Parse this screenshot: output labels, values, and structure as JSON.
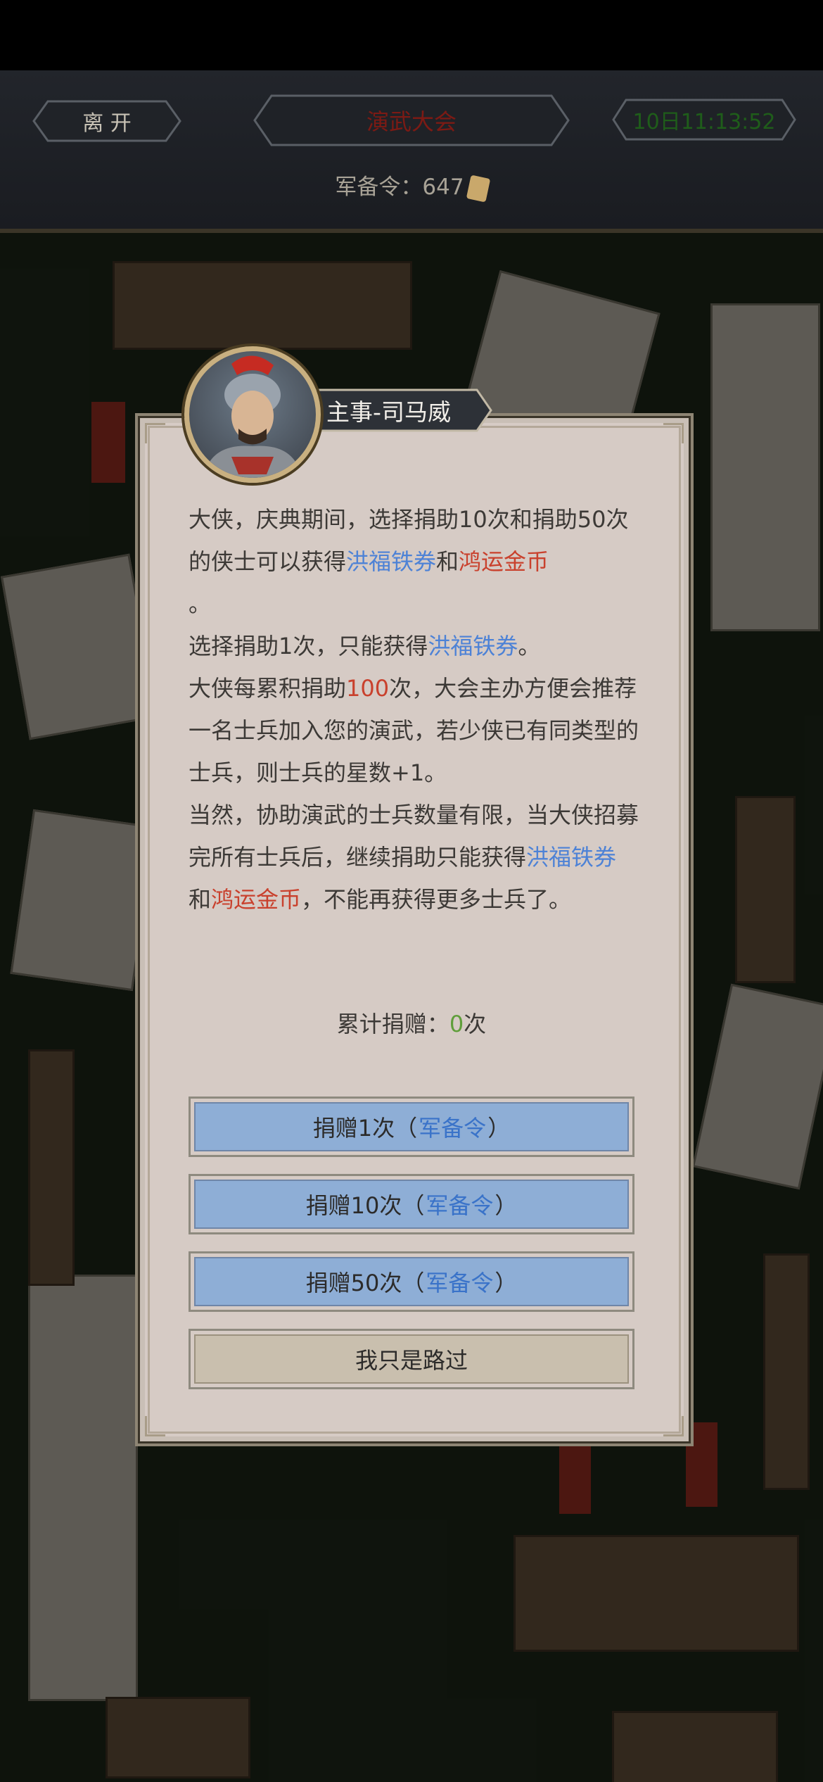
{
  "topbar": {
    "leave_label": "离 开",
    "title": "演武大会",
    "timer": "10日11:13:52",
    "resource_label": "军备令：647"
  },
  "dialog": {
    "speaker": "主事-司马威",
    "para1_a": "大侠，庆典期间，选择捐助10次和捐助50次的侠士可以获得",
    "para1_blue": "洪福铁券",
    "para1_and": "和",
    "para1_red": "鸿运金币",
    "para1_end": "。",
    "para2_a": "选择捐助1次，只能获得",
    "para2_blue": "洪福铁券",
    "para2_end": "。",
    "para3_a": "大侠每累积捐助",
    "para3_red": "100",
    "para3_b": "次，大会主办方便会推荐一名士兵加入您的演武，若少侠已有同类型的士兵，则士兵的星数+1。",
    "para4_a": "当然，协助演武的士兵数量有限，当大侠招募完所有士兵后，继续捐助只能获得",
    "para4_blue": "洪福铁券",
    "para4_and": "和",
    "para4_red": "鸿运金币",
    "para4_end": "，不能再获得更多士兵了。",
    "total_label": "累计捐赠：",
    "total_value": "0",
    "total_unit": "次",
    "buttons": [
      {
        "prefix": "捐赠1次（",
        "currency": "军备令",
        "suffix": "）"
      },
      {
        "prefix": "捐赠10次（",
        "currency": "军备令",
        "suffix": "）"
      },
      {
        "prefix": "捐赠50次（",
        "currency": "军备令",
        "suffix": "）"
      }
    ],
    "pass_label": "我只是路过"
  },
  "colors": {
    "accent_blue": "#4d82d6",
    "accent_red": "#c9412d",
    "count_green": "#5f9e3a",
    "title_red": "#8e1d16",
    "timer_green": "#1f5d1a"
  }
}
